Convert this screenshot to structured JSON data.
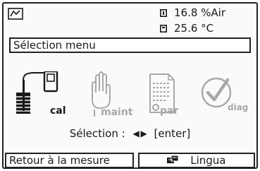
{
  "status_bar": {
    "reading_1": "16.8 %Air",
    "reading_2": "25.6 °C",
    "status_icon": "measurement-graph-icon",
    "reading_indicator_icon": "sensor-indicator-icon"
  },
  "menu": {
    "title": "Sélection menu",
    "items": [
      {
        "label": "cal",
        "icon": "calibration-icon",
        "active": true
      },
      {
        "label": "maint",
        "icon": "hand-maintenance-icon",
        "active": false
      },
      {
        "label": "par",
        "icon": "parameter-document-icon",
        "active": false
      },
      {
        "label": "diag",
        "icon": "diagnostics-check-icon",
        "active": false
      }
    ]
  },
  "selection": {
    "label": "Sélection :",
    "arrows": "◀ ▶",
    "action": "[enter]"
  },
  "softkeys": {
    "left": "Retour à la mesure",
    "right": "Lingua",
    "right_icon": "language-icon"
  },
  "colors": {
    "active": "#1a1a1a",
    "inactive": "#a8a8a8",
    "background": "#fafafa"
  }
}
